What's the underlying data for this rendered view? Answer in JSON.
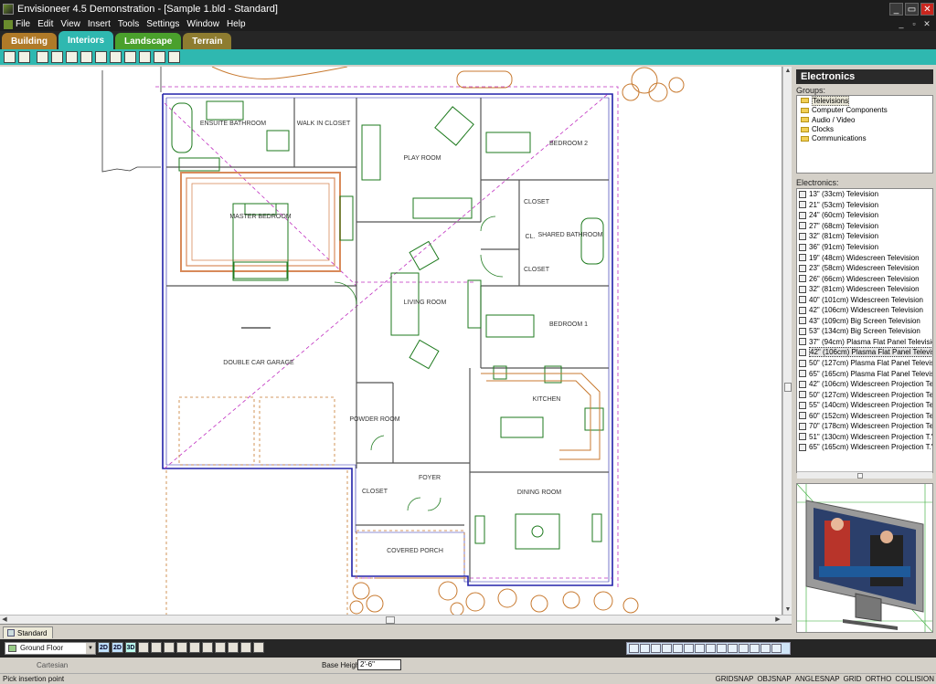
{
  "window": {
    "title": "Envisioneer 4.5 Demonstration - [Sample 1.bld - Standard]",
    "controls": [
      "_",
      "▭",
      "✕"
    ]
  },
  "menu": {
    "items": [
      "File",
      "Edit",
      "View",
      "Insert",
      "Tools",
      "Settings",
      "Window",
      "Help"
    ],
    "doc_controls": [
      "_",
      "▫",
      "✕"
    ]
  },
  "mode_tabs": [
    "Building",
    "Interiors",
    "Landscape",
    "Terrain"
  ],
  "active_tab": "Interiors",
  "colors": {
    "interiors_tab": "#2fb8b0",
    "building_tab": "#b07a28",
    "landscape_tab": "#4aa02c",
    "terrain_tab": "#8e7c30",
    "wall_outline": "#2222aa",
    "furniture": "#1e7a1e",
    "landscape_plants": "#c87a30",
    "rug": "#d88a5a"
  },
  "floor_plan": {
    "rooms": {
      "ensuite": "ENSUITE BATHROOM",
      "walkin": "WALK IN CLOSET",
      "play": "PLAY ROOM",
      "bed2": "BEDROOM 2",
      "master": "MASTER BEDROOM",
      "closet1": "CLOSET",
      "c2": "CL.",
      "shared": "SHARED BATHROOM",
      "closet2": "CLOSET",
      "living": "LIVING ROOM",
      "bed1": "BEDROOM 1",
      "garage": "DOUBLE CAR GARAGE",
      "kitchen": "KITCHEN",
      "powder": "POWDER ROOM",
      "foyer": "FOYER",
      "closet3": "CLOSET",
      "dining": "DINING ROOM",
      "porch": "COVERED PORCH"
    }
  },
  "side_panel": {
    "title": "Electronics",
    "groups_label": "Groups:",
    "groups": [
      "Televisions",
      "Computer Components",
      "Audio / Video",
      "Clocks",
      "Communications"
    ],
    "selected_group": "Televisions",
    "items_label": "Electronics:",
    "items": [
      "13\" (33cm) Television",
      "21\" (53cm) Television",
      "24\" (60cm) Television",
      "27\" (68cm) Television",
      "32\" (81cm) Television",
      "36\" (91cm) Television",
      "19\" (48cm) Widescreen Television",
      "23\" (58cm) Widescreen Television",
      "26\" (66cm) Widescreen Television",
      "32\" (81cm) Widescreen Television",
      "40\" (101cm) Widescreen Television",
      "42\" (106cm) Widescreen Television",
      "43\" (109cm) Big Screen Television",
      "53\" (134cm) Big Screen Television",
      "37\" (94cm) Plasma Flat Panel Television",
      "42\" (106cm) Plasma Flat Panel Television",
      "50\" (127cm) Plasma Flat Panel Television",
      "65\" (165cm) Plasma Flat Panel Television",
      "42\" (106cm) Widescreen Projection Television",
      "50\" (127cm) Widescreen Projection Television",
      "55\" (140cm) Widescreen Projection Television",
      "60\" (152cm) Widescreen Projection Television",
      "70\" (178cm) Widescreen Projection Television",
      "51\" (130cm) Widescreen Projection T.V.",
      "65\" (165cm) Widescreen Projection T.V."
    ],
    "selected_item_index": 15
  },
  "floor_tab": "Standard",
  "bottom_bar": {
    "floor": "Ground Floor",
    "view_2d": "2D",
    "view_2d_alt": "2D",
    "view_3d": "3D"
  },
  "status": {
    "coordinate_mode": "Cartesian",
    "base_height_label": "Base Height",
    "base_height_value": "2'-6\"",
    "message": "Pick insertion point",
    "toggles": [
      "GRIDSNAP",
      "OBJSNAP",
      "ANGLESNAP",
      "GRID",
      "ORTHO",
      "COLLISION"
    ]
  }
}
